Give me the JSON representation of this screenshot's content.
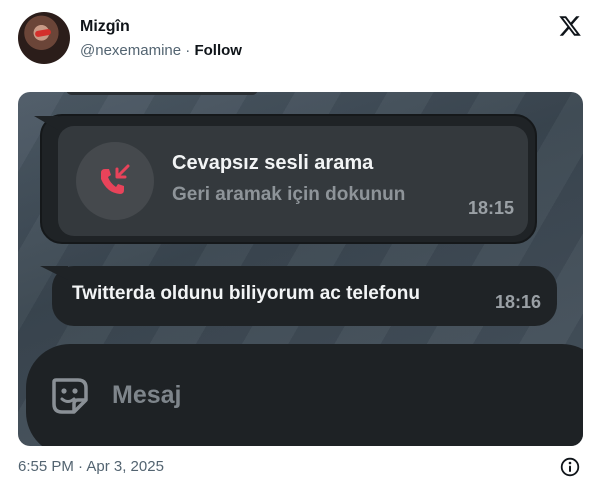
{
  "tweet": {
    "author": {
      "name": "Mizgîn",
      "handle": "@nexemamine",
      "separator": " · ",
      "follow_label": "Follow"
    },
    "brand_icon": "x-logo-icon",
    "timestamp": "6:55 PM · Apr 3, 2025",
    "info_icon": "info-icon"
  },
  "chat": {
    "missed_call": {
      "icon": "missed-call-icon",
      "title": "Cevapsız sesli arama",
      "subtitle": "Geri aramak için dokunun",
      "time": "18:15"
    },
    "message": {
      "text": "Twitterda oldunu biliyorum ac telefonu",
      "time": "18:16"
    },
    "composer": {
      "placeholder": "Mesaj",
      "value": "",
      "icon": "sticker-icon"
    }
  },
  "colors": {
    "missed_call_red": "#e8435a",
    "bubble_bg": "#1f2326",
    "inner_bg": "#34393d",
    "secondary_text": "#536471"
  }
}
